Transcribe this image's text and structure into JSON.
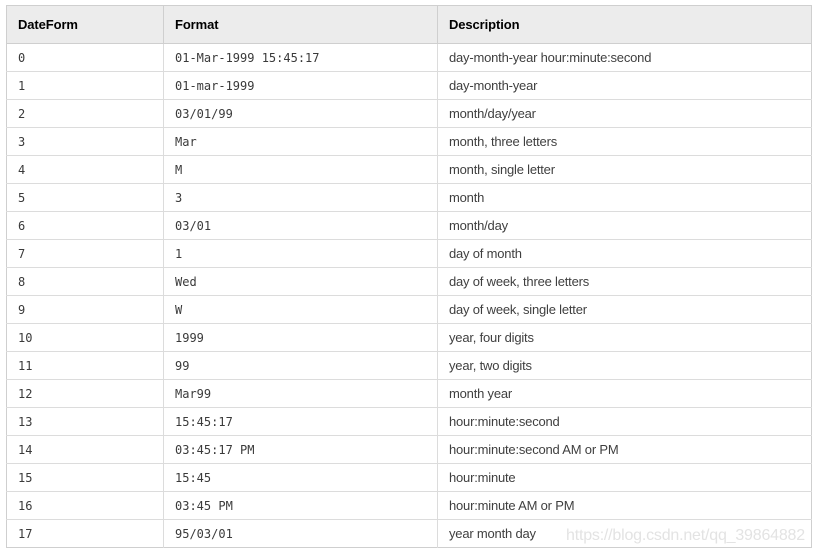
{
  "table": {
    "columns": [
      "DateForm",
      "Format",
      "Description"
    ],
    "rows": [
      {
        "dateform": "0",
        "format": "01-Mar-1999 15:45:17",
        "description": "day-month-year hour:minute:second"
      },
      {
        "dateform": "1",
        "format": "01-mar-1999",
        "description": "day-month-year"
      },
      {
        "dateform": "2",
        "format": "03/01/99",
        "description": "month/day/year"
      },
      {
        "dateform": "3",
        "format": "Mar",
        "description": "month, three letters"
      },
      {
        "dateform": "4",
        "format": "M",
        "description": "month, single letter"
      },
      {
        "dateform": "5",
        "format": "3",
        "description": "month"
      },
      {
        "dateform": "6",
        "format": "03/01",
        "description": "month/day"
      },
      {
        "dateform": "7",
        "format": "1",
        "description": "day of month"
      },
      {
        "dateform": "8",
        "format": "Wed",
        "description": "day of week, three letters"
      },
      {
        "dateform": "9",
        "format": "W",
        "description": "day of week, single letter"
      },
      {
        "dateform": "10",
        "format": "1999",
        "description": "year, four digits"
      },
      {
        "dateform": "11",
        "format": "99",
        "description": "year, two digits"
      },
      {
        "dateform": "12",
        "format": "Mar99",
        "description": "month year"
      },
      {
        "dateform": "13",
        "format": "15:45:17",
        "description": "hour:minute:second"
      },
      {
        "dateform": "14",
        "format": "03:45:17 PM",
        "description": "hour:minute:second AM or PM"
      },
      {
        "dateform": "15",
        "format": "15:45",
        "description": "hour:minute"
      },
      {
        "dateform": "16",
        "format": "03:45 PM",
        "description": "hour:minute AM or PM"
      },
      {
        "dateform": "17",
        "format": "95/03/01",
        "description": "year month day"
      }
    ]
  },
  "watermark": {
    "text": "https://blog.csdn.net/qq_39864882"
  },
  "colors": {
    "header_background": "#ececec",
    "header_text": "#000000",
    "body_text": "#3f3f3f",
    "mono_text": "#3a3a3a",
    "outer_border": "#cfcfcf",
    "row_border": "#dcdcdc",
    "page_background": "#ffffff",
    "watermark_text": "#e3e3e3"
  }
}
